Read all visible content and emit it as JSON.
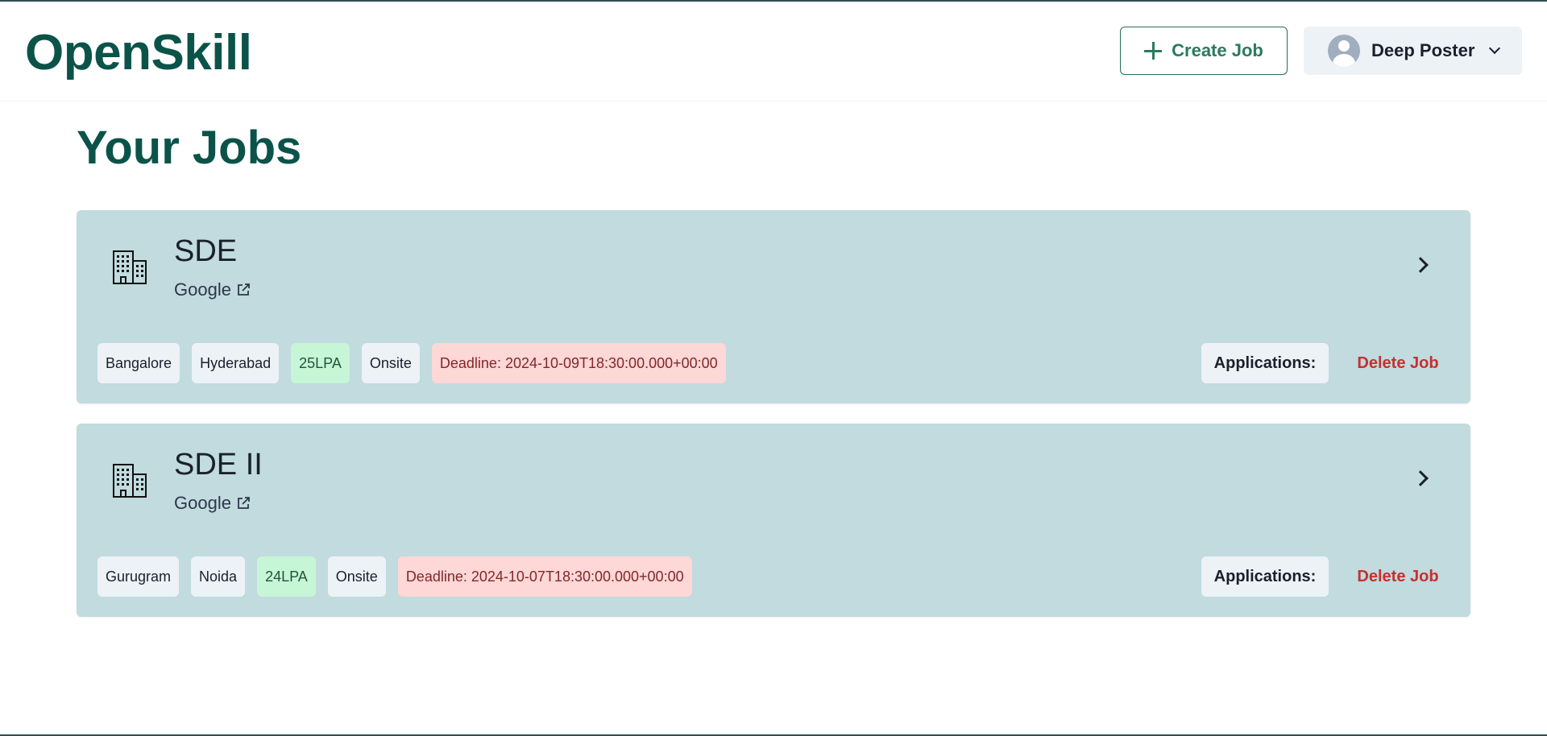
{
  "header": {
    "logo": "OpenSkill",
    "create_job_label": "Create Job",
    "user_name": "Deep Poster"
  },
  "page": {
    "title": "Your Jobs"
  },
  "jobs": [
    {
      "title": "SDE",
      "company": "Google",
      "tags": [
        "Bangalore",
        "Hyderabad"
      ],
      "salary": "25LPA",
      "mode": "Onsite",
      "deadline": "Deadline: 2024-10-09T18:30:00.000+00:00",
      "applications_label": "Applications:",
      "delete_label": "Delete Job"
    },
    {
      "title": "SDE II",
      "company": "Google",
      "tags": [
        "Gurugram",
        "Noida"
      ],
      "salary": "24LPA",
      "mode": "Onsite",
      "deadline": "Deadline: 2024-10-07T18:30:00.000+00:00",
      "applications_label": "Applications:",
      "delete_label": "Delete Job"
    }
  ],
  "colors": {
    "brand": "#0b5349",
    "card_bg": "#c1dbdf",
    "delete": "#c53030",
    "salary_bg": "#c6f6d5",
    "deadline_bg": "#fed7d7"
  },
  "icons": {
    "create": "plus-icon",
    "user": "user-avatar-icon",
    "dropdown": "chevron-down-icon",
    "job": "building-icon",
    "company_link": "external-link-icon",
    "open_job": "chevron-right-icon"
  }
}
